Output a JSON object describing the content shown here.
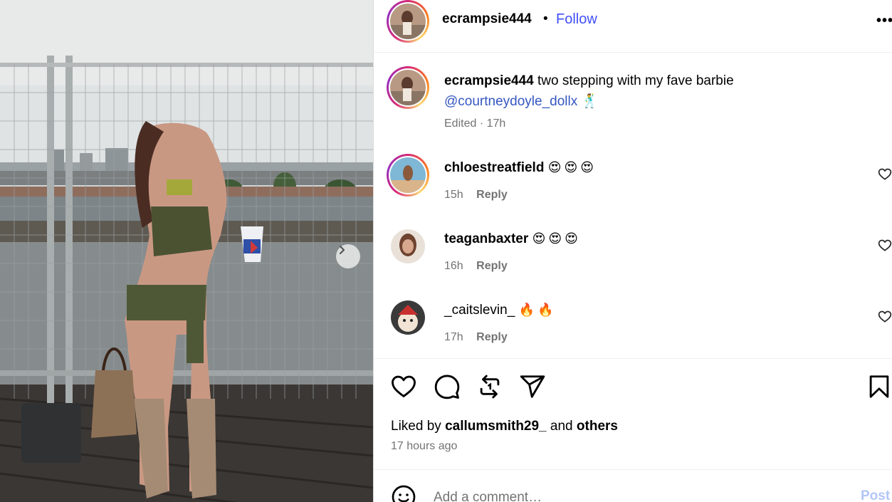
{
  "post": {
    "username": "ecrampsie444",
    "follow_label": "Follow",
    "dot": "•",
    "more_label": "•••"
  },
  "caption": {
    "username": "ecrampsie444",
    "text": "two stepping with my fave barbie",
    "mention": "@courtneydoyle_dollx",
    "emoji": "🕺",
    "meta": "Edited · 17h"
  },
  "comments": [
    {
      "username": "chloestreatfield",
      "text": "😍😍😍",
      "time": "15h",
      "reply_label": "Reply"
    },
    {
      "username": "teaganbaxter",
      "text": "😍😍😍",
      "time": "16h",
      "reply_label": "Reply"
    },
    {
      "username": "_caitslevin_",
      "text": "🔥🔥",
      "time": "17h",
      "reply_label": "Reply"
    }
  ],
  "likes": {
    "prefix": "Liked by",
    "user": "callumsmith29_",
    "conjunction": "and",
    "others": "others",
    "time_ago": "17 hours ago"
  },
  "composer": {
    "placeholder": "Add a comment…",
    "post_label": "Post"
  },
  "icons": {
    "next": "chevron-right-icon",
    "like": "heart-icon",
    "comment": "comment-bubble-icon",
    "repost": "repost-icon",
    "share": "send-icon",
    "save": "bookmark-icon",
    "emoji": "smiley-icon"
  },
  "colors": {
    "follow": "#4150f7",
    "mention": "#3557c2",
    "post_button_disabled": "#b3c6f8",
    "muted_text": "#737373"
  }
}
